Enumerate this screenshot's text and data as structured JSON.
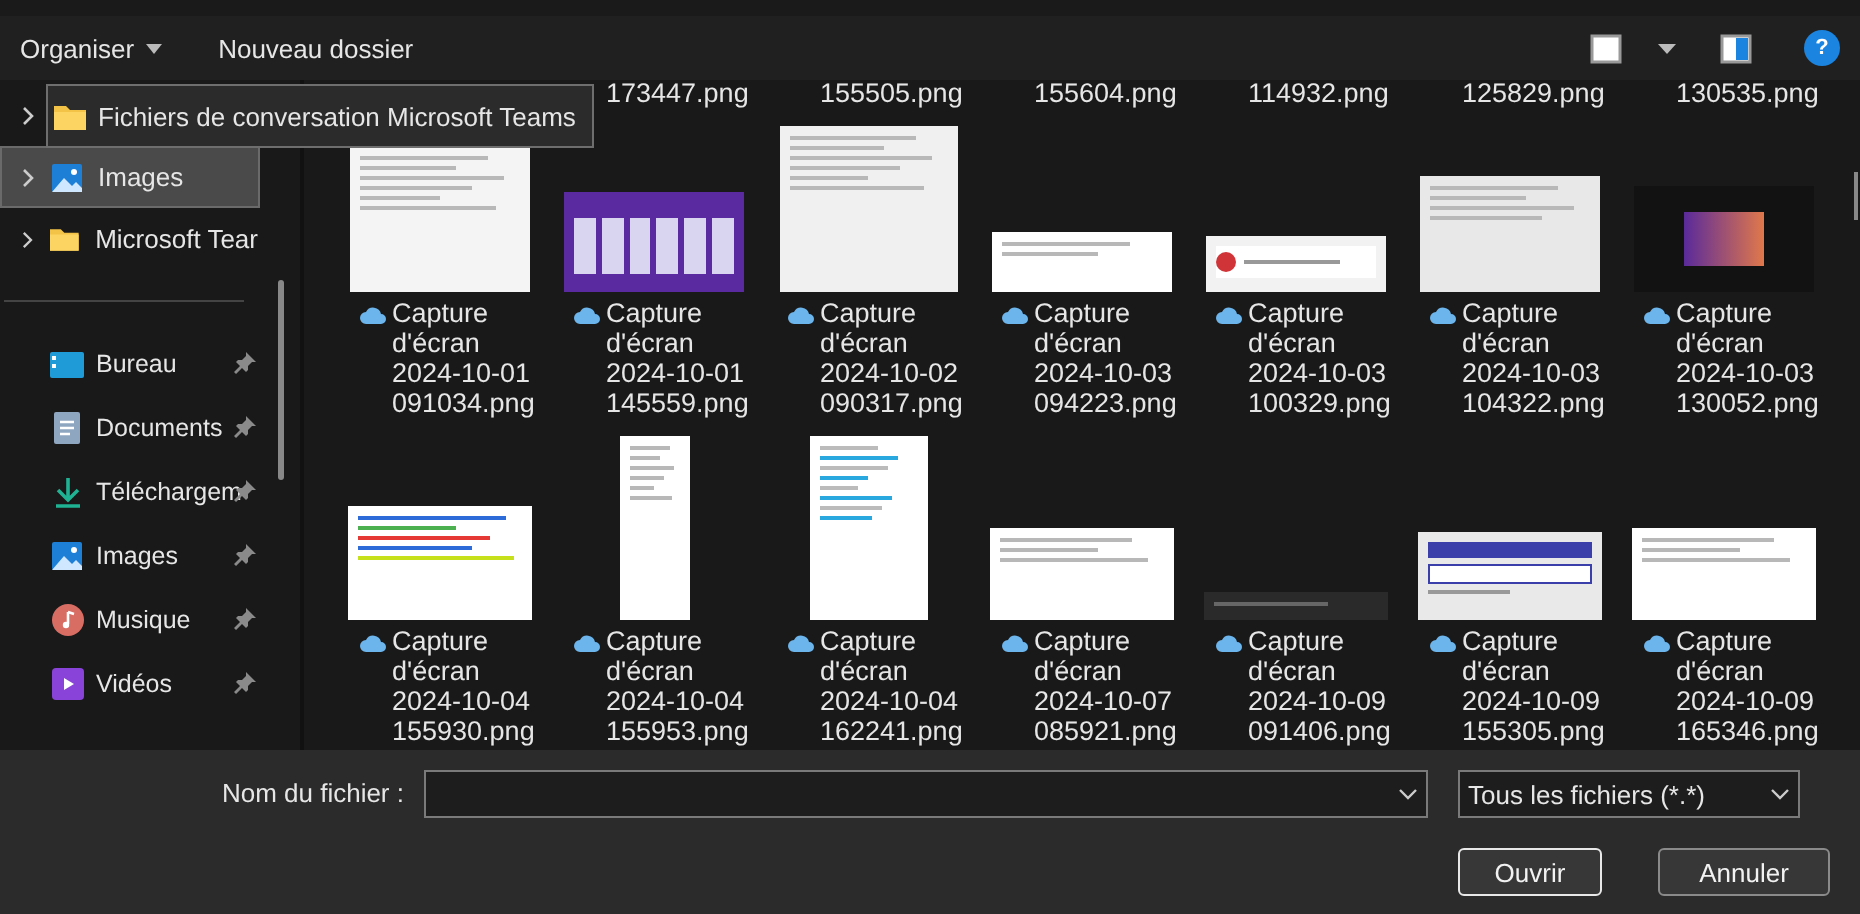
{
  "toolbar": {
    "organize": "Organiser",
    "new_folder": "Nouveau dossier",
    "help": "?"
  },
  "tree": [
    {
      "label": "Fichiers de conversation Microsoft Teams",
      "kind": "folder",
      "selected": false,
      "tooltip": true
    },
    {
      "label": "Images",
      "kind": "pictures",
      "selected": true,
      "tooltip": false
    },
    {
      "label": "Microsoft Tear",
      "kind": "folder",
      "selected": false,
      "tooltip": false
    }
  ],
  "quick_access": [
    {
      "label": "Bureau",
      "kind": "desktop",
      "pinned": true
    },
    {
      "label": "Documents",
      "kind": "documents",
      "pinned": true
    },
    {
      "label": "Téléchargem",
      "kind": "downloads",
      "pinned": true
    },
    {
      "label": "Images",
      "kind": "pictures",
      "pinned": true
    },
    {
      "label": "Musique",
      "kind": "music",
      "pinned": true
    },
    {
      "label": "Vidéos",
      "kind": "videos",
      "pinned": true
    }
  ],
  "partial_row": [
    "173447.png",
    "155505.png",
    "155604.png",
    "114932.png",
    "125829.png",
    "130535.png"
  ],
  "files": [
    {
      "name": "Capture d'écran 2024-10-01 091034.png",
      "kind": "document"
    },
    {
      "name": "Capture d'écran 2024-10-01 145559.png",
      "kind": "slides"
    },
    {
      "name": "Capture d'écran 2024-10-02 090317.png",
      "kind": "dialog"
    },
    {
      "name": "Capture d'écran 2024-10-03 094223.png",
      "kind": "note"
    },
    {
      "name": "Capture d'écran 2024-10-03 100329.png",
      "kind": "error"
    },
    {
      "name": "Capture d'écran 2024-10-03 104322.png",
      "kind": "screen"
    },
    {
      "name": "Capture d'écran 2024-10-03 130052.png",
      "kind": "dark"
    },
    {
      "name": "Capture d'écran 2024-10-04 155930.png",
      "kind": "diagram"
    },
    {
      "name": "Capture d'écran 2024-10-04 155953.png",
      "kind": "tall"
    },
    {
      "name": "Capture d'écran 2024-10-04 162241.png",
      "kind": "report"
    },
    {
      "name": "Capture d'écran 2024-10-07 085921.png",
      "kind": "page"
    },
    {
      "name": "Capture d'écran 2024-10-09 091406.png",
      "kind": "strip"
    },
    {
      "name": "Capture d'écran 2024-10-09 155305.png",
      "kind": "form"
    },
    {
      "name": "Capture d'écran 2024-10-09 165346.png",
      "kind": "page"
    }
  ],
  "bottom": {
    "filename_label": "Nom du fichier :",
    "filter": "Tous les fichiers (*.*)",
    "buttons": [
      {
        "label": "Ouvrir",
        "default": true
      },
      {
        "label": "Annuler",
        "default": false
      }
    ]
  }
}
